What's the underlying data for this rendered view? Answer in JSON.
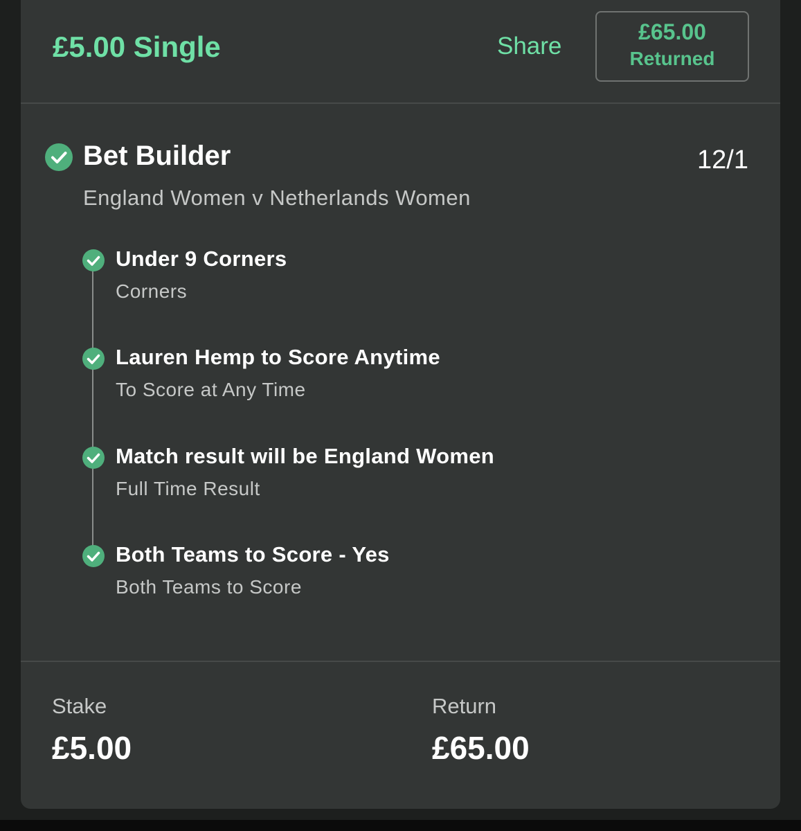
{
  "header": {
    "stake_type": "£5.00 Single",
    "share_label": "Share",
    "returned_amount": "£65.00",
    "returned_label": "Returned"
  },
  "bet": {
    "title": "Bet Builder",
    "odds": "12/1",
    "event": "England Women v Netherlands Women",
    "legs": [
      {
        "selection": "Under 9 Corners",
        "market": "Corners"
      },
      {
        "selection": "Lauren Hemp to Score Anytime",
        "market": "To Score at Any Time"
      },
      {
        "selection": "Match result will be England Women",
        "market": "Full Time Result"
      },
      {
        "selection": "Both Teams to Score - Yes",
        "market": "Both Teams to Score"
      }
    ]
  },
  "footer": {
    "stake_label": "Stake",
    "stake_value": "£5.00",
    "return_label": "Return",
    "return_value": "£65.00"
  },
  "colors": {
    "accent_green": "#6fe0a6",
    "check_green": "#4faf7c",
    "card_background": "#333635"
  },
  "icons": {
    "status": "check-circle-icon"
  }
}
